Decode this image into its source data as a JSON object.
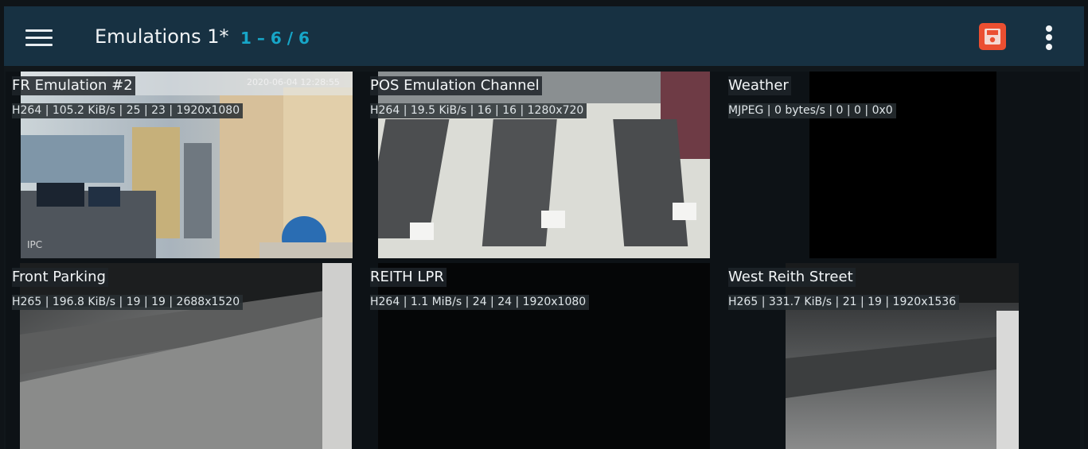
{
  "header": {
    "title": "Emulations 1*",
    "range": "1 – 6 / 6",
    "menu_icon": "hamburger-menu-icon",
    "save_icon": "save-floppy-icon",
    "more_icon": "more-vertical-icon"
  },
  "colors": {
    "topbar": "#173142",
    "background": "#11171b",
    "accent": "#17a6c8",
    "save": "#eb4f31"
  },
  "tiles": [
    {
      "name": "FR Emulation #2",
      "meta": "H264 | 105.2 KiB/s | 25 | 23 | 1920x1080",
      "timestamp": "2020-06-04 12:28:55",
      "overlay": "IPC"
    },
    {
      "name": "POS Emulation Channel",
      "meta": "H264 | 19.5 KiB/s | 16 | 16 | 1280x720"
    },
    {
      "name": "Weather",
      "meta": "MJPEG | 0 bytes/s | 0 | 0 | 0x0"
    },
    {
      "name": "Front Parking",
      "meta": "H265 | 196.8 KiB/s | 19 | 19 | 2688x1520"
    },
    {
      "name": "REITH LPR",
      "meta": "H264 | 1.1 MiB/s | 24 | 24 | 1920x1080"
    },
    {
      "name": "West Reith Street",
      "meta": "H265 | 331.7 KiB/s | 21 | 19 | 1920x1536"
    }
  ]
}
